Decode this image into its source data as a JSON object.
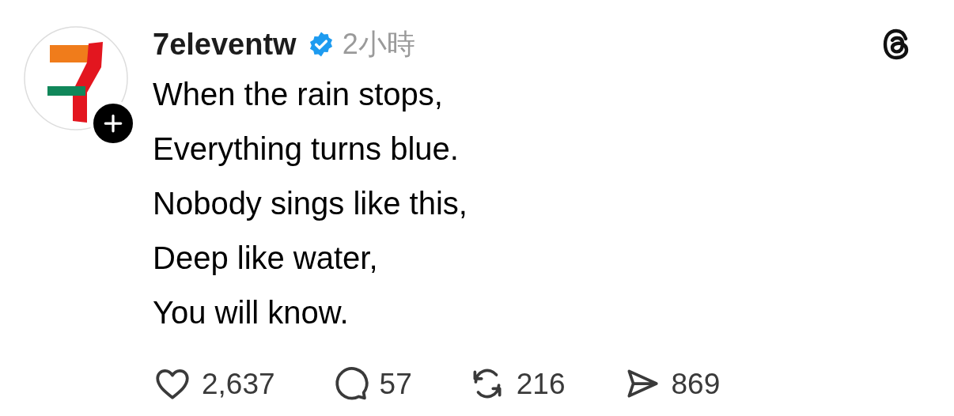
{
  "post": {
    "author": "7eleventw",
    "verified": true,
    "time": "2小時",
    "lines": [
      "When the rain stops,",
      "Everything turns blue.",
      "Nobody sings like this,",
      "Deep like water,",
      "You will know."
    ],
    "actions": [
      {
        "kind": "like",
        "count": "2,637"
      },
      {
        "kind": "comment",
        "count": "57"
      },
      {
        "kind": "repost",
        "count": "216"
      },
      {
        "kind": "share",
        "count": "869"
      }
    ]
  }
}
